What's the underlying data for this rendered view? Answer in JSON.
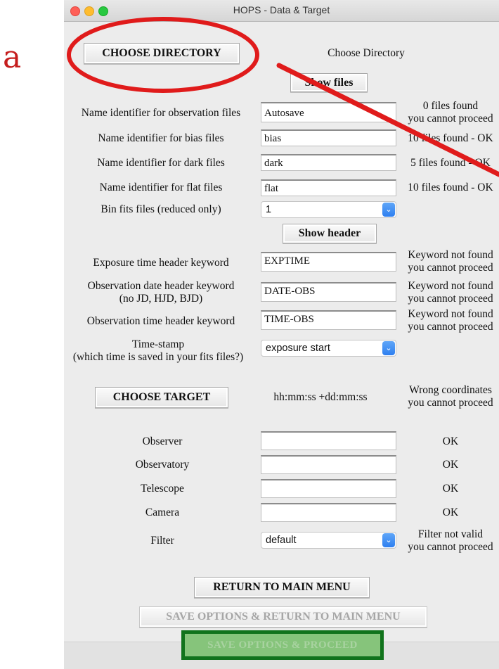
{
  "panel_letter": "a",
  "window": {
    "title": "HOPS - Data & Target"
  },
  "directory": {
    "button": "CHOOSE DIRECTORY",
    "status": "Choose Directory",
    "show_files": "Show files"
  },
  "file_rows": [
    {
      "label": "Name identifier for observation files",
      "value": "Autosave",
      "status1": "0 files found",
      "status2": "you cannot proceed"
    },
    {
      "label": "Name identifier for bias files",
      "value": "bias",
      "status1": "10 files found - OK",
      "status2": ""
    },
    {
      "label": "Name identifier for dark files",
      "value": "dark",
      "status1": "5 files found - OK",
      "status2": ""
    },
    {
      "label": "Name identifier for flat files",
      "value": "flat",
      "status1": "10 files found - OK",
      "status2": ""
    }
  ],
  "bin": {
    "label": "Bin fits files (reduced only)",
    "value": "1"
  },
  "show_header": "Show header",
  "header_rows": [
    {
      "label1": "Exposure time header keyword",
      "label2": "",
      "value": "EXPTIME",
      "status1": "Keyword not found",
      "status2": "you cannot proceed"
    },
    {
      "label1": "Observation date header keyword",
      "label2": "(no JD, HJD, BJD)",
      "value": "DATE-OBS",
      "status1": "Keyword not found",
      "status2": "you cannot proceed"
    },
    {
      "label1": "Observation time header keyword",
      "label2": "",
      "value": "TIME-OBS",
      "status1": "Keyword not found",
      "status2": "you cannot proceed"
    }
  ],
  "timestamp": {
    "label1": "Time-stamp",
    "label2": "(which time is saved in your fits files?)",
    "value": "exposure start"
  },
  "target": {
    "button": "CHOOSE TARGET",
    "coords": "hh:mm:ss +dd:mm:ss",
    "status1": "Wrong coordinates",
    "status2": "you cannot proceed"
  },
  "info_rows": [
    {
      "label": "Observer",
      "value": "",
      "status": "OK"
    },
    {
      "label": "Observatory",
      "value": "",
      "status": "OK"
    },
    {
      "label": "Telescope",
      "value": "",
      "status": "OK"
    },
    {
      "label": "Camera",
      "value": "",
      "status": "OK"
    }
  ],
  "filter": {
    "label": "Filter",
    "value": "default",
    "status1": "Filter not valid",
    "status2": "you cannot proceed"
  },
  "buttons": {
    "return": "RETURN TO MAIN MENU",
    "save_return": "SAVE OPTIONS & RETURN TO MAIN MENU",
    "save_proceed": "SAVE OPTIONS & PROCEED"
  },
  "annotation_color": "#e01b1b",
  "highlight_color": "#11731c"
}
